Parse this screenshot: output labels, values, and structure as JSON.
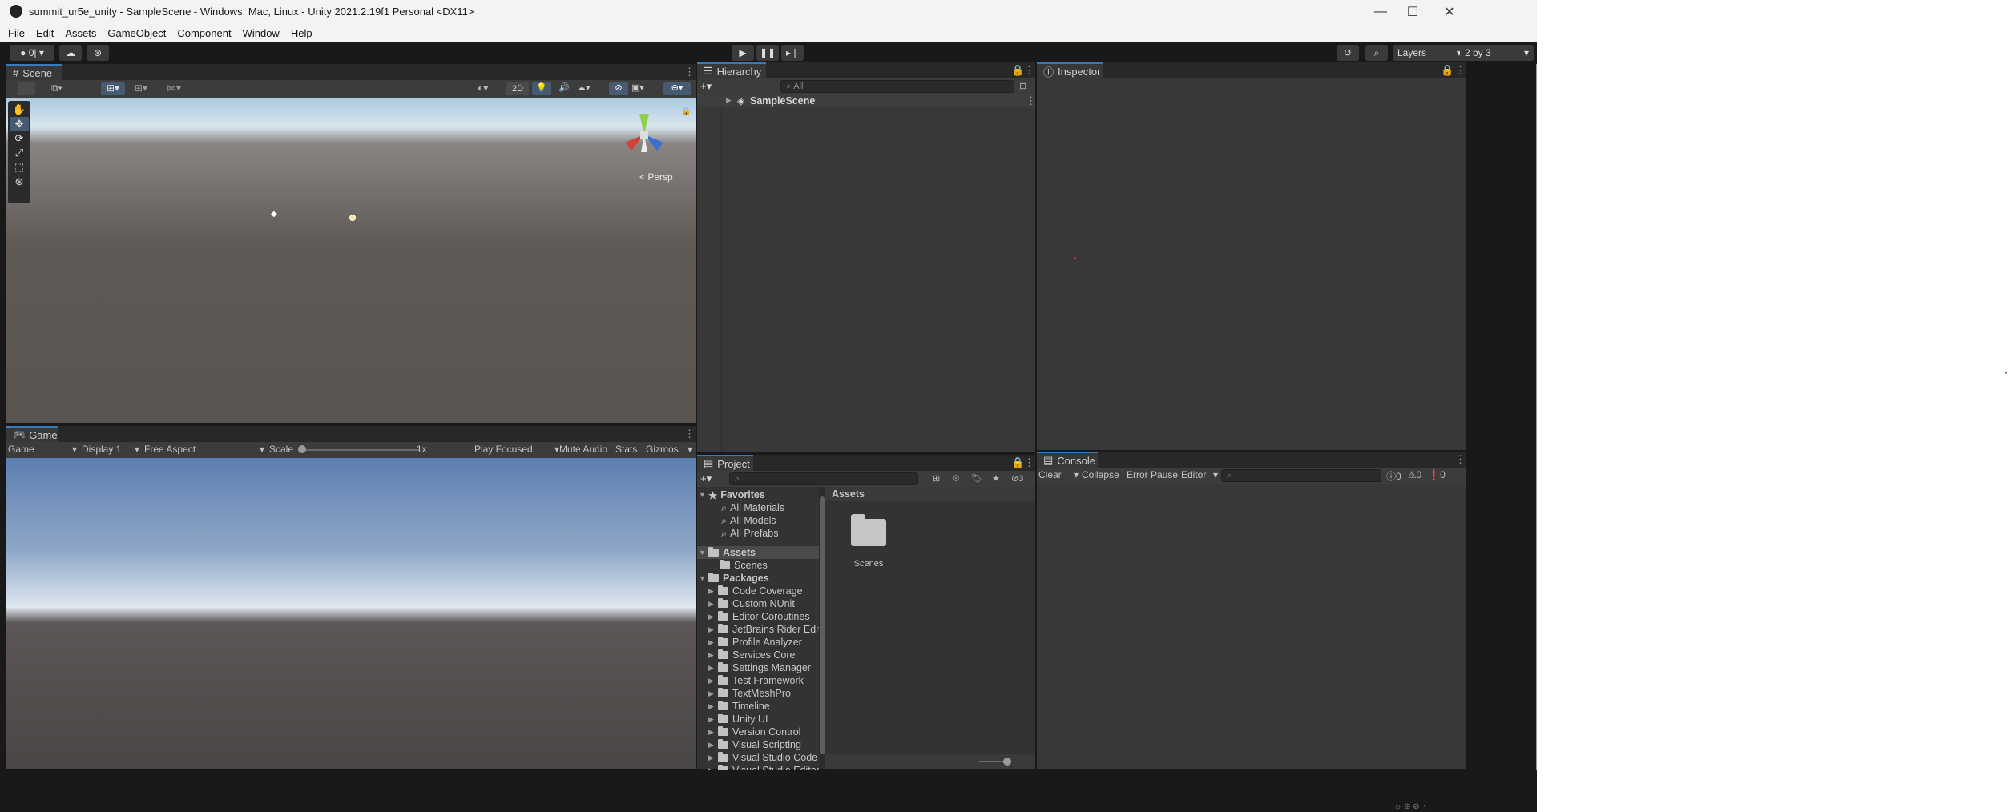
{
  "window": {
    "title": "summit_ur5e_unity - SampleScene - Windows, Mac, Linux - Unity 2021.2.19f1 Personal <DX11>",
    "controls": {
      "minimize": "—",
      "maximize": "☐",
      "close": "✕"
    }
  },
  "menu": [
    "File",
    "Edit",
    "Assets",
    "GameObject",
    "Component",
    "Window",
    "Help"
  ],
  "toolbar": {
    "account_label": "0|",
    "layers_label": "Layers",
    "layout_label": "2 by 3"
  },
  "scene": {
    "tab_label": "Scene",
    "mode_2d": "2D",
    "persp_label": "Persp",
    "gizmo_axes": {
      "x": "x",
      "y": "y",
      "z": "z"
    }
  },
  "game": {
    "tab_label": "Game",
    "view_select": "Game",
    "display_select": "Display 1",
    "aspect_select": "Free Aspect",
    "scale_label": "Scale",
    "scale_value": "1x",
    "scale_fraction": 0.0,
    "play_focused": "Play Focused",
    "mute_audio": "Mute Audio",
    "stats": "Stats",
    "gizmos": "Gizmos"
  },
  "hierarchy": {
    "tab_label": "Hierarchy",
    "search_placeholder": "All",
    "items": [
      {
        "label": "SampleScene"
      }
    ]
  },
  "inspector": {
    "tab_label": "Inspector"
  },
  "project": {
    "tab_label": "Project",
    "hidden_count": "3",
    "favorites_label": "Favorites",
    "favorites": [
      "All Materials",
      "All Models",
      "All Prefabs"
    ],
    "assets_label": "Assets",
    "assets_children": [
      "Scenes"
    ],
    "packages_label": "Packages",
    "packages": [
      "Code Coverage",
      "Custom NUnit",
      "Editor Coroutines",
      "JetBrains Rider Edit",
      "Profile Analyzer",
      "Services Core",
      "Settings Manager",
      "Test Framework",
      "TextMeshPro",
      "Timeline",
      "Unity UI",
      "Version Control",
      "Visual Scripting",
      "Visual Studio Code",
      "Visual Studio Editor"
    ],
    "content_header": "Assets",
    "content_items": [
      {
        "label": "Scenes"
      }
    ]
  },
  "console": {
    "tab_label": "Console",
    "clear": "Clear",
    "collapse": "Collapse",
    "error_pause": "Error Pause",
    "editor": "Editor",
    "log_count": "0",
    "warn_count": "0",
    "error_count": "0"
  }
}
